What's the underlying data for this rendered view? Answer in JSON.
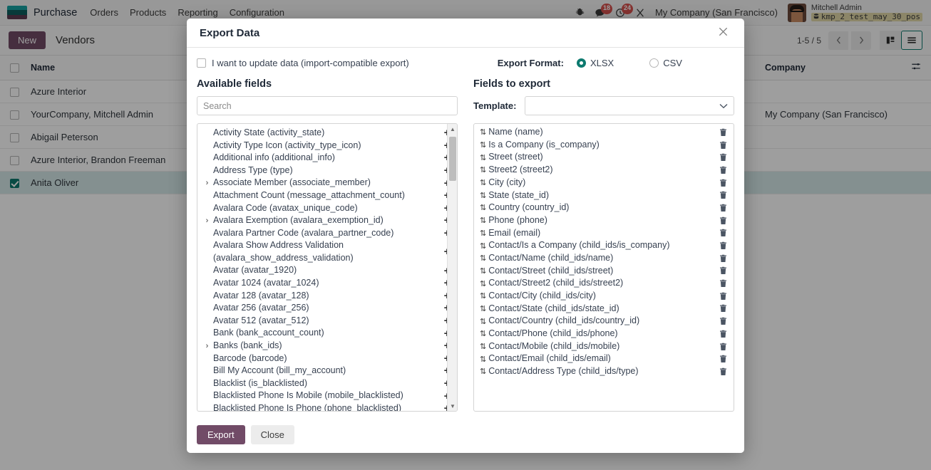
{
  "navbar": {
    "app_name": "Purchase",
    "menu": [
      "Orders",
      "Products",
      "Reporting",
      "Configuration"
    ],
    "icons": {
      "bug": "bug-icon",
      "messages": "chat-icon",
      "activities": "clock-icon",
      "shortcut": "scissors-icon"
    },
    "message_count": "18",
    "activity_count": "24",
    "company": "My Company (San Francisco)",
    "user_name": "Mitchell Admin",
    "database": "kmp_2_test_may_30_pos"
  },
  "control_panel": {
    "new_label": "New",
    "title": "Vendors",
    "pager": "1-5 / 5"
  },
  "list": {
    "columns": [
      "Name",
      "Company"
    ],
    "rows": [
      {
        "name": "Azure Interior",
        "company": "",
        "selected": false
      },
      {
        "name": "YourCompany, Mitchell Admin",
        "company": "My Company (San Francisco)",
        "selected": false
      },
      {
        "name": "Abigail Peterson",
        "company": "",
        "selected": false
      },
      {
        "name": "Azure Interior, Brandon Freeman",
        "company": "",
        "selected": false
      },
      {
        "name": "Anita Oliver",
        "company": "",
        "selected": true
      }
    ]
  },
  "dialog": {
    "title": "Export Data",
    "update_checkbox_label": "I want to update data (import-compatible export)",
    "update_checkbox_checked": false,
    "export_format_label": "Export Format:",
    "formats": [
      {
        "label": "XLSX",
        "selected": true
      },
      {
        "label": "CSV",
        "selected": false
      }
    ],
    "available_heading": "Available fields",
    "search_placeholder": "Search",
    "search_value": "",
    "export_heading": "Fields to export",
    "template_label": "Template:",
    "template_value": "",
    "available_fields": [
      {
        "label": "Activity State (activity_state)",
        "expandable": false
      },
      {
        "label": "Activity Type Icon (activity_type_icon)",
        "expandable": false
      },
      {
        "label": "Additional info (additional_info)",
        "expandable": false
      },
      {
        "label": "Address Type (type)",
        "expandable": false
      },
      {
        "label": "Associate Member (associate_member)",
        "expandable": true
      },
      {
        "label": "Attachment Count (message_attachment_count)",
        "expandable": false
      },
      {
        "label": "Avalara Code (avatax_unique_code)",
        "expandable": false
      },
      {
        "label": "Avalara Exemption (avalara_exemption_id)",
        "expandable": true
      },
      {
        "label": "Avalara Partner Code (avalara_partner_code)",
        "expandable": false
      },
      {
        "label": "Avalara Show Address Validation (avalara_show_address_validation)",
        "expandable": false
      },
      {
        "label": "Avatar (avatar_1920)",
        "expandable": false
      },
      {
        "label": "Avatar 1024 (avatar_1024)",
        "expandable": false
      },
      {
        "label": "Avatar 128 (avatar_128)",
        "expandable": false
      },
      {
        "label": "Avatar 256 (avatar_256)",
        "expandable": false
      },
      {
        "label": "Avatar 512 (avatar_512)",
        "expandable": false
      },
      {
        "label": "Bank (bank_account_count)",
        "expandable": false
      },
      {
        "label": "Banks (bank_ids)",
        "expandable": true
      },
      {
        "label": "Barcode (barcode)",
        "expandable": false
      },
      {
        "label": "Bill My Account (bill_my_account)",
        "expandable": false
      },
      {
        "label": "Blacklist (is_blacklisted)",
        "expandable": false
      },
      {
        "label": "Blacklisted Phone Is Mobile (mobile_blacklisted)",
        "expandable": false
      },
      {
        "label": "Blacklisted Phone Is Phone (phone_blacklisted)",
        "expandable": false
      }
    ],
    "export_fields": [
      "Name (name)",
      "Is a Company (is_company)",
      "Street (street)",
      "Street2 (street2)",
      "City (city)",
      "State (state_id)",
      "Country (country_id)",
      "Phone (phone)",
      "Email (email)",
      "Contact/Is a Company (child_ids/is_company)",
      "Contact/Name (child_ids/name)",
      "Contact/Street (child_ids/street)",
      "Contact/Street2 (child_ids/street2)",
      "Contact/City (child_ids/city)",
      "Contact/State (child_ids/state_id)",
      "Contact/Country (child_ids/country_id)",
      "Contact/Phone (child_ids/phone)",
      "Contact/Mobile (child_ids/mobile)",
      "Contact/Email (child_ids/email)",
      "Contact/Address Type (child_ids/type)"
    ],
    "export_button": "Export",
    "close_button": "Close"
  },
  "colors": {
    "primary": "#714b67",
    "accent": "#0d7a6f",
    "badge": "#d9534f"
  }
}
